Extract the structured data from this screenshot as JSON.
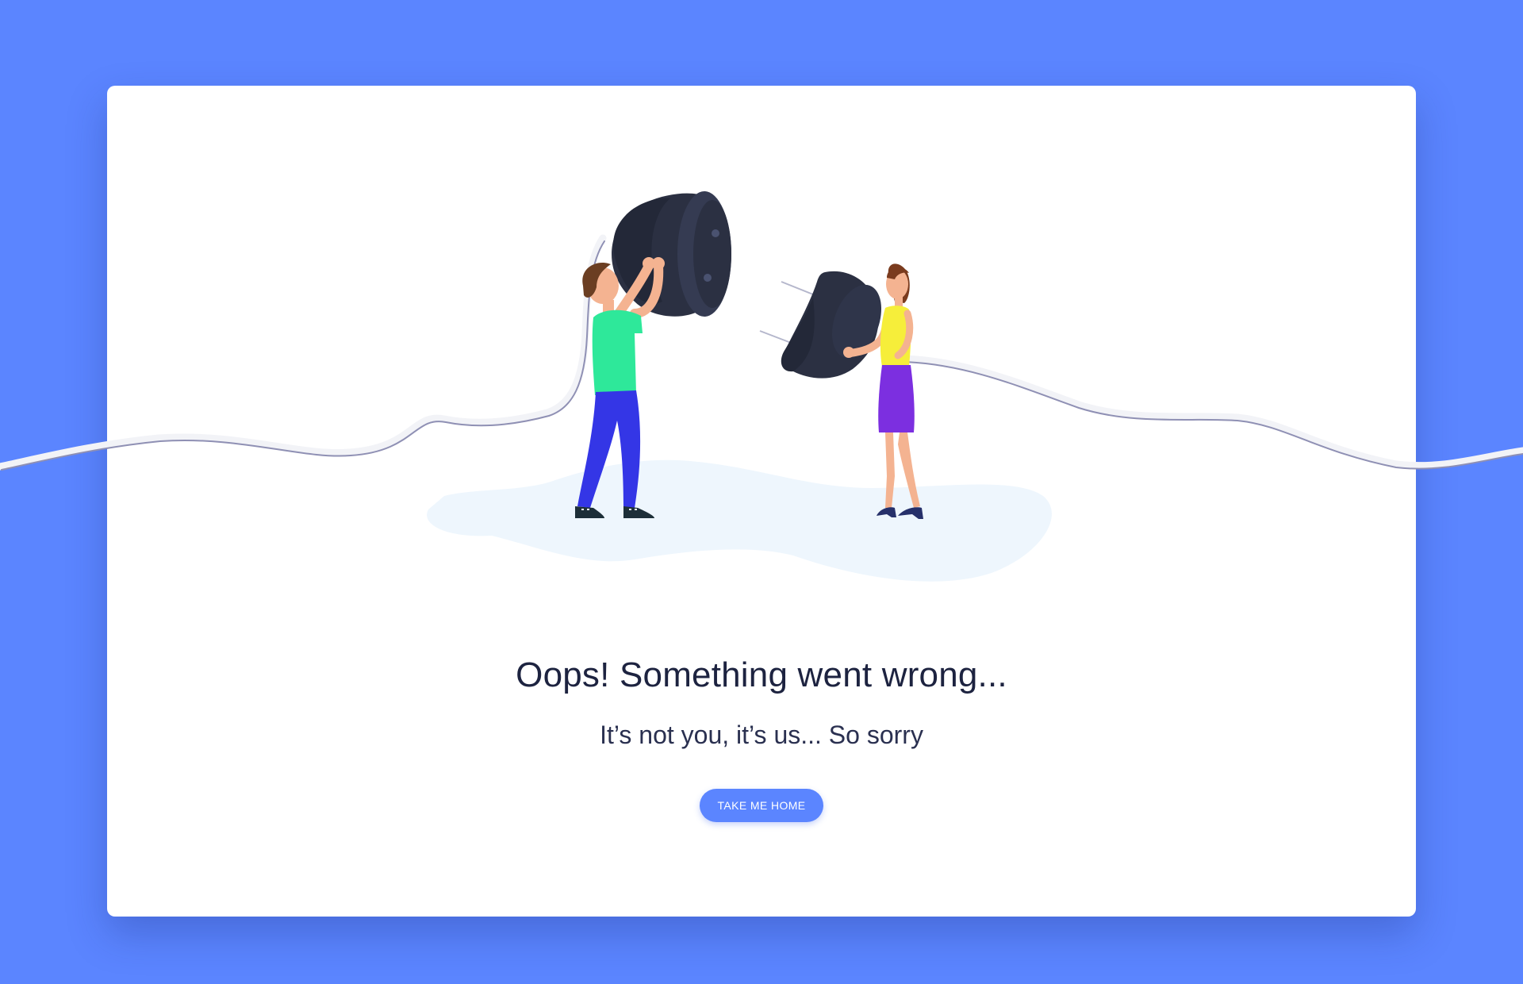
{
  "error_page": {
    "headline": "Oops! Something went wrong...",
    "subline": "It’s not you, it’s us... So sorry",
    "button_label": "TAKE ME HOME"
  },
  "colors": {
    "background": "#5b85ff",
    "card": "#ffffff",
    "button": "#5b85ff",
    "headline_text": "#1d2340",
    "plug": "#2b3042",
    "man_shirt": "#2ee89a",
    "man_pants": "#3436e6",
    "woman_top": "#f6ee3a",
    "woman_skirt": "#7c2fe0"
  },
  "illustration": {
    "subject": "two people holding unplugged plug and socket",
    "icons": [
      "plug-icon",
      "socket-icon",
      "cable-icon"
    ]
  }
}
